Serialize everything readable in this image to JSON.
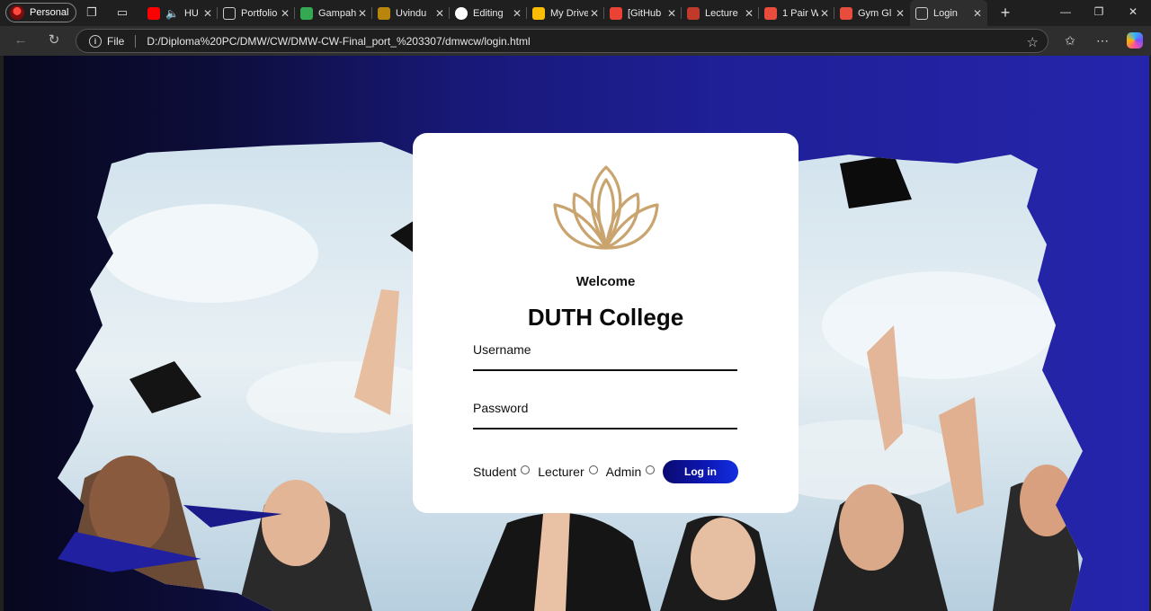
{
  "browser": {
    "profile_label": "Personal",
    "tabs": [
      {
        "label": "HU",
        "favicon_color": "#ff0000",
        "active": false
      },
      {
        "label": "Portfolio",
        "favicon_color": "#cfcfcf",
        "active": false
      },
      {
        "label": "Gampaha",
        "favicon_color": "#34a853",
        "active": false
      },
      {
        "label": "Uvindu",
        "favicon_color": "#b8860b",
        "active": false
      },
      {
        "label": "Editing",
        "favicon_color": "#ffffff",
        "active": false
      },
      {
        "label": "My Drive",
        "favicon_color": "#fbbc04",
        "active": false
      },
      {
        "label": "[GitHub",
        "favicon_color": "#ea4335",
        "active": false
      },
      {
        "label": "Lecture",
        "favicon_color": "#c0392b",
        "active": false
      },
      {
        "label": "1 Pair W",
        "favicon_color": "#e74c3c",
        "active": false
      },
      {
        "label": "Gym Gl",
        "favicon_color": "#e74c3c",
        "active": false
      },
      {
        "label": "Login",
        "favicon_color": "#cfcfcf",
        "active": true
      }
    ],
    "address": {
      "scheme_label": "File",
      "url": "D:/Diploma%20PC/DMW/CW/DMW-CW-Final_port_%203307/dmwcw/login.html"
    }
  },
  "login": {
    "welcome": "Welcome",
    "college": "DUTH College",
    "username_label": "Username",
    "password_label": "Password",
    "roles": [
      "Student",
      "Lecturer",
      "Admin"
    ],
    "login_button": "Log in",
    "logo_color": "#c9a46e",
    "button_color": "#0a0a6e"
  }
}
